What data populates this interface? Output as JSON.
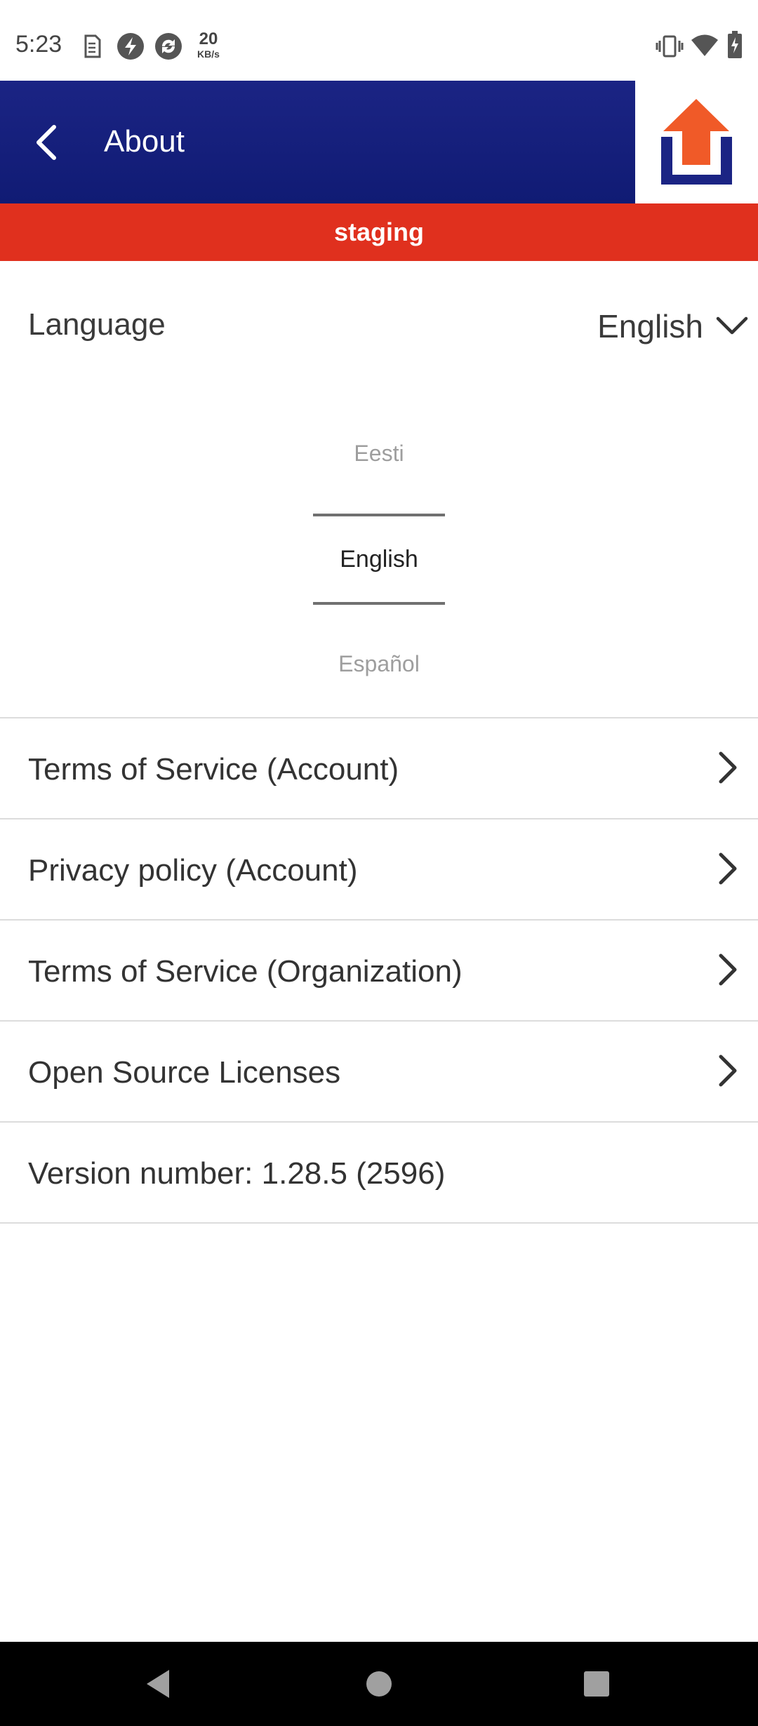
{
  "status_bar": {
    "time": "5:23",
    "network_speed_value": "20",
    "network_speed_unit": "KB/s",
    "left_icons": [
      "sim-icon",
      "flash-icon",
      "sync-icon"
    ],
    "right_icons": [
      "vibrate-icon",
      "wifi-icon",
      "battery-icon"
    ]
  },
  "app_bar": {
    "title": "About",
    "color": "#101b74"
  },
  "logo": {
    "arrow_color": "#f05a28",
    "tray_color": "#1b2484"
  },
  "env_banner": {
    "label": "staging",
    "color": "#e0301e"
  },
  "language": {
    "label": "Language",
    "selected": "English",
    "picker": {
      "previous": "Eesti",
      "current": "English",
      "next": "Español"
    }
  },
  "menu": {
    "items": [
      {
        "label": "Terms of Service (Account)"
      },
      {
        "label": "Privacy policy (Account)"
      },
      {
        "label": "Terms of Service (Organization)"
      },
      {
        "label": "Open Source Licenses"
      }
    ],
    "version": "Version number: 1.28.5 (2596)"
  },
  "nav_bar": {
    "buttons": [
      "back-icon",
      "home-icon",
      "recents-icon"
    ]
  }
}
